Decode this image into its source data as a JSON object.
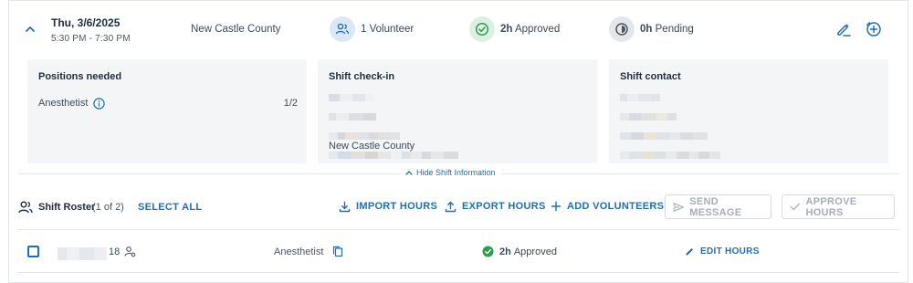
{
  "shift": {
    "date": "Thu, 3/6/2025",
    "time": "5:30 PM - 7:30 PM",
    "location": "New Castle County",
    "volunteers": "1 Volunteer",
    "approved_value": "2h",
    "approved_label": "Approved",
    "pending_value": "0h",
    "pending_label": "Pending"
  },
  "panels": {
    "positions": {
      "title": "Positions needed",
      "items": [
        {
          "name": "Anesthetist",
          "count": "1/2"
        }
      ]
    },
    "checkin": {
      "title": "Shift check-in",
      "county": "New Castle County"
    },
    "contact": {
      "title": "Shift contact"
    }
  },
  "toggle": {
    "label": "Hide Shift Information"
  },
  "roster": {
    "title": "Shift Roster",
    "count": "(1 of 2)",
    "select_all": "SELECT ALL",
    "import": "IMPORT HOURS",
    "export": "EXPORT HOURS",
    "add": "ADD VOLUNTEERS",
    "send": "SEND MESSAGE",
    "approve": "APPROVE HOURS"
  },
  "volunteer_row": {
    "id_suffix": "18",
    "position": "Anesthetist",
    "hours_value": "2h",
    "hours_label": "Approved",
    "edit": "EDIT HOURS"
  },
  "colors": {
    "accent": "#1f6fb8",
    "approved_green": "#2e9d4f",
    "muted": "#a7adb5"
  },
  "icons": {
    "collapse": "chevron-up-icon",
    "volunteers": "people-icon",
    "approved": "check-circle-icon",
    "pending": "clock-half-icon",
    "edit": "pencil-icon",
    "add": "add-circle-icon",
    "info": "info-icon",
    "import": "upload-icon",
    "export": "download-icon",
    "add_volunteer": "plus-icon",
    "send": "send-icon",
    "approve": "check-icon",
    "copy": "copy-icon"
  }
}
